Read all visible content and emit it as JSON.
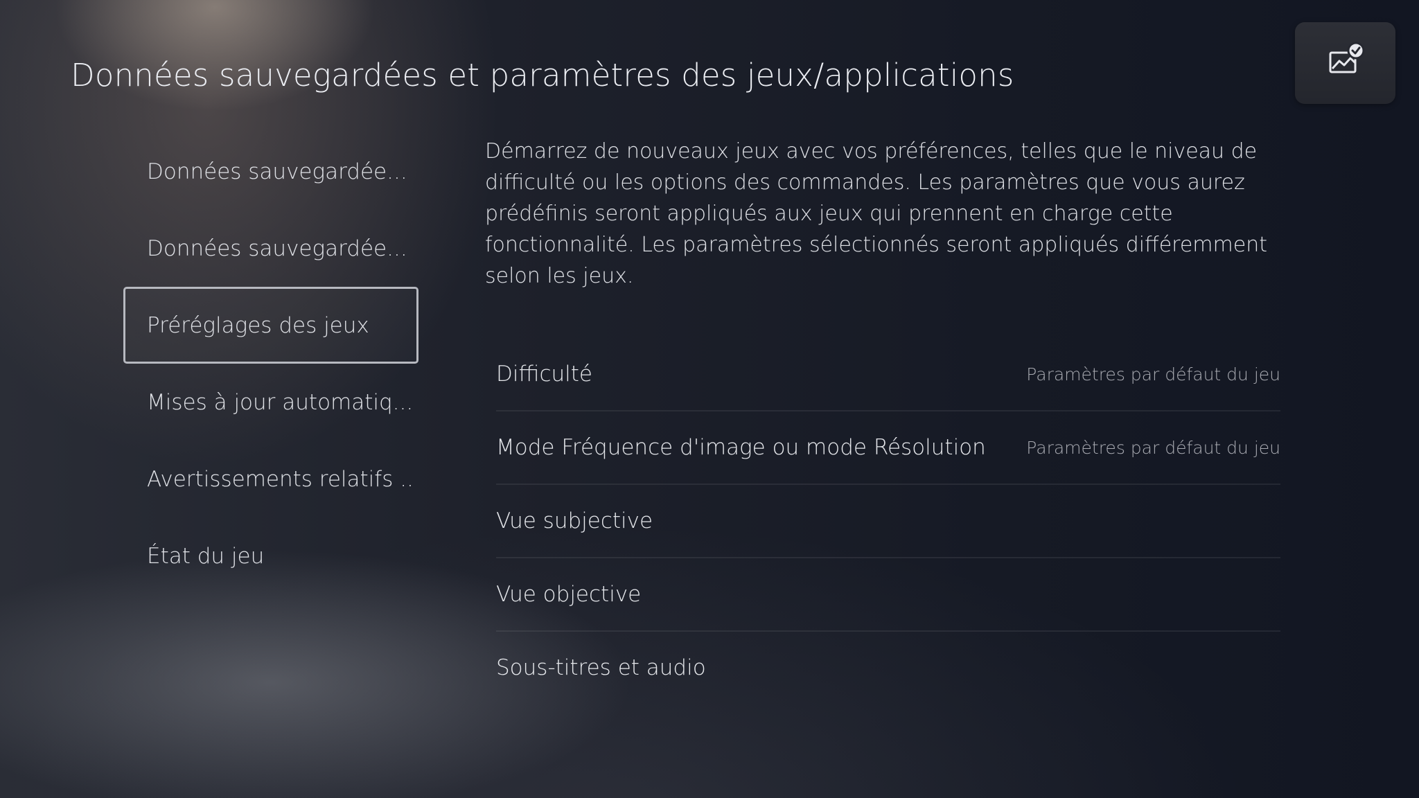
{
  "header": {
    "title": "Données sauvegardées et paramètres des jeux/applications",
    "corner_icon": "screenshot-check-icon"
  },
  "sidebar": {
    "items": [
      {
        "label": "Données sauvegardée..."
      },
      {
        "label": "Données sauvegardée..."
      },
      {
        "label": "Préréglages des jeux",
        "selected": true
      },
      {
        "label": "Mises à jour automatiq..."
      },
      {
        "label": "Avertissements relatifs ..."
      },
      {
        "label": "État du jeu"
      }
    ]
  },
  "main": {
    "description": "Démarrez de nouveaux jeux avec vos préférences, telles que le niveau de difficulté ou les options des commandes. Les paramètres que vous aurez prédéfinis seront appliqués aux jeux qui prennent en charge cette fonctionnalité. Les paramètres sélectionnés seront appliqués différemment selon les jeux.",
    "settings": [
      {
        "label": "Difficulté",
        "value": "Paramètres par défaut du jeu"
      },
      {
        "label": "Mode Fréquence d'image ou mode Résolution",
        "value": "Paramètres par défaut du jeu"
      },
      {
        "label": "Vue subjective",
        "value": ""
      },
      {
        "label": "Vue objective",
        "value": ""
      },
      {
        "label": "Sous-titres et audio",
        "value": ""
      }
    ]
  }
}
